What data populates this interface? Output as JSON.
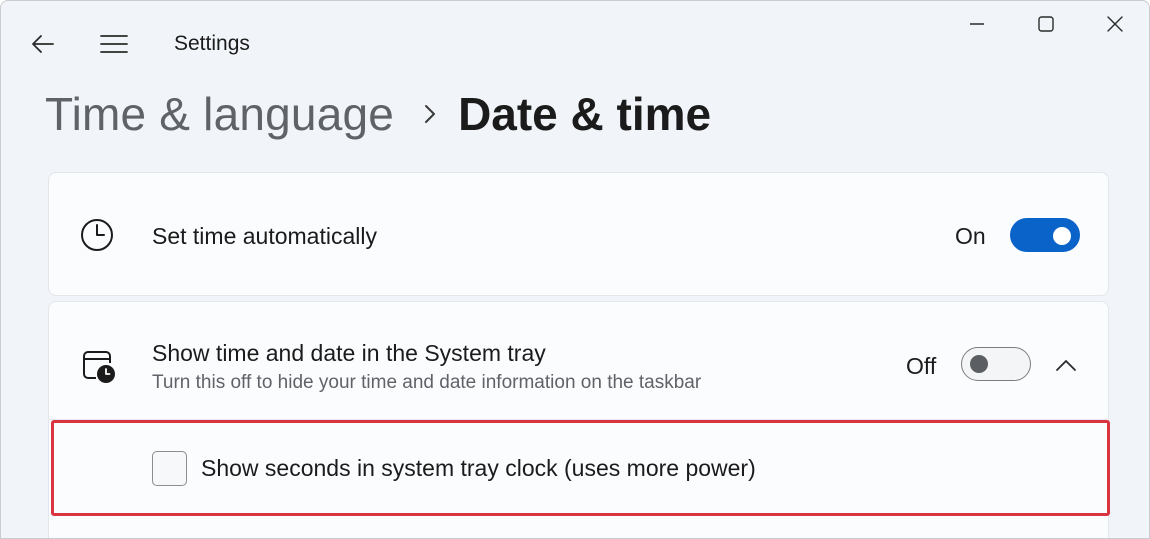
{
  "titlebar": {
    "app_title": "Settings",
    "back_icon": "arrow-left-icon",
    "menu_icon": "hamburger-menu-icon",
    "minimize_icon": "minimize-icon",
    "maximize_icon": "maximize-icon",
    "close_icon": "close-icon"
  },
  "breadcrumb": {
    "parent": "Time & language",
    "separator_icon": "chevron-right-icon",
    "current": "Date & time"
  },
  "settings": [
    {
      "icon": "clock-icon",
      "label": "Set time automatically",
      "state_label": "On",
      "toggle_on": true
    },
    {
      "icon": "calendar-clock-icon",
      "label": "Show time and date in the System tray",
      "description": "Turn this off to hide your time and date information on the taskbar",
      "state_label": "Off",
      "toggle_on": false,
      "expanded": true,
      "expand_icon": "chevron-up-icon",
      "sub_options": [
        {
          "label": "Show seconds in system tray clock (uses more power)",
          "checked": false,
          "highlighted": true
        }
      ]
    }
  ],
  "colors": {
    "accent": "#0a63c9",
    "highlight_border": "#d9343f",
    "window_background": "#f1f4f9",
    "card_background": "#fbfcfe"
  }
}
